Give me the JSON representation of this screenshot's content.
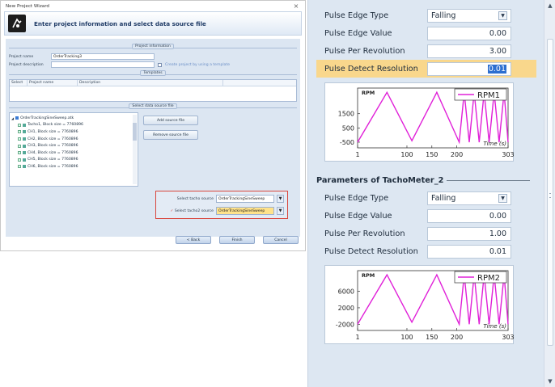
{
  "wizard": {
    "window_title": "New Project Wizard",
    "close_glyph": "×",
    "heading": "Enter project information and select data source file",
    "project_info_group": "Project information",
    "project_name_label": "Project name",
    "project_name_value": "OrderTracking3",
    "project_description_label": "Project description",
    "template_checkbox_label": "Create project by using a template",
    "templates_group": "Templates",
    "templates_columns": [
      "Select",
      "Project name",
      "Description"
    ],
    "data_source_group": "Select data source file",
    "tree_root": "OrderTrackingSineSweep.atk",
    "tree_children": [
      "Tacho1, Block size = 7760896",
      "CH1, Block size = 7760896",
      "CH2, Block size = 7760896",
      "CH3, Block size = 7760896",
      "CH4, Block size = 7760896",
      "CH5, Block size = 7760896",
      "CH6, Block size = 7760896"
    ],
    "add_source_button": "Add source file",
    "remove_source_button": "Remove source file",
    "tacho_source_label": "Select tacho source",
    "tacho_source_value": "OrderTrackingSineSweep",
    "tacho2_source_label": "Select tacho2 source",
    "tacho2_source_value": "OrderTrackingSineSweep",
    "back_button": "< Back",
    "finish_button": "Finish",
    "cancel_button": "Cancel"
  },
  "panel": {
    "tacho1": {
      "pulse_edge_type_label": "Pulse Edge Type",
      "pulse_edge_type_value": "Falling",
      "pulse_edge_value_label": "Pulse Edge Value",
      "pulse_edge_value": "0.00",
      "pulse_per_rev_label": "Pulse Per Revolution",
      "pulse_per_rev_value": "3.00",
      "pulse_detect_res_label": "Pulse Detect Resolution",
      "pulse_detect_res_value": "0.01"
    },
    "section2_title": "Parameters of TachoMeter_2",
    "tacho2": {
      "pulse_edge_type_label": "Pulse Edge Type",
      "pulse_edge_type_value": "Falling",
      "pulse_edge_value_label": "Pulse Edge Value",
      "pulse_edge_value": "0.00",
      "pulse_per_rev_label": "Pulse Per Revolution",
      "pulse_per_rev_value": "1.00",
      "pulse_detect_res_label": "Pulse Detect Resolution",
      "pulse_detect_res_value": "0.01"
    },
    "scroll_up_glyph": "▲",
    "scroll_down_glyph": "▼",
    "dropdown_glyph": "▼"
  },
  "colors": {
    "series": "#e020d8",
    "panel_bg": "#dde7f2",
    "highlight_row": "#f9d78c",
    "selection": "#2d6fd0",
    "red_outline": "#d9463c"
  },
  "chart_data": [
    {
      "type": "line",
      "ylabel": "RPM",
      "xlabel": "Time (s)",
      "legend": "top-right",
      "series": [
        {
          "name": "RPM1",
          "x": [
            1,
            60,
            110,
            160,
            205,
            215,
            225,
            235,
            245,
            255,
            265,
            275,
            285,
            295,
            303
          ],
          "y": [
            -500,
            3000,
            -400,
            3000,
            -500,
            3000,
            -500,
            3000,
            -500,
            3000,
            -500,
            3000,
            -500,
            3000,
            -500
          ]
        }
      ],
      "y_ticks": [
        1500,
        500,
        -500
      ],
      "x_ticks": [
        1,
        100,
        150,
        200,
        303
      ],
      "xlim": [
        1,
        303
      ],
      "ylim": [
        -900,
        3300
      ]
    },
    {
      "type": "line",
      "ylabel": "RPM",
      "xlabel": "Time (s)",
      "legend": "top-right",
      "series": [
        {
          "name": "RPM2",
          "x": [
            1,
            60,
            110,
            160,
            205,
            215,
            225,
            235,
            245,
            255,
            265,
            275,
            285,
            295,
            303
          ],
          "y": [
            -2000,
            10000,
            -1500,
            10000,
            -2000,
            10000,
            -2000,
            10000,
            -2000,
            10000,
            -2000,
            10000,
            -2000,
            10000,
            -2000
          ]
        }
      ],
      "y_ticks": [
        6000,
        2000,
        -2000
      ],
      "x_ticks": [
        1,
        100,
        150,
        200,
        303
      ],
      "xlim": [
        1,
        303
      ],
      "ylim": [
        -3500,
        11000
      ]
    }
  ]
}
